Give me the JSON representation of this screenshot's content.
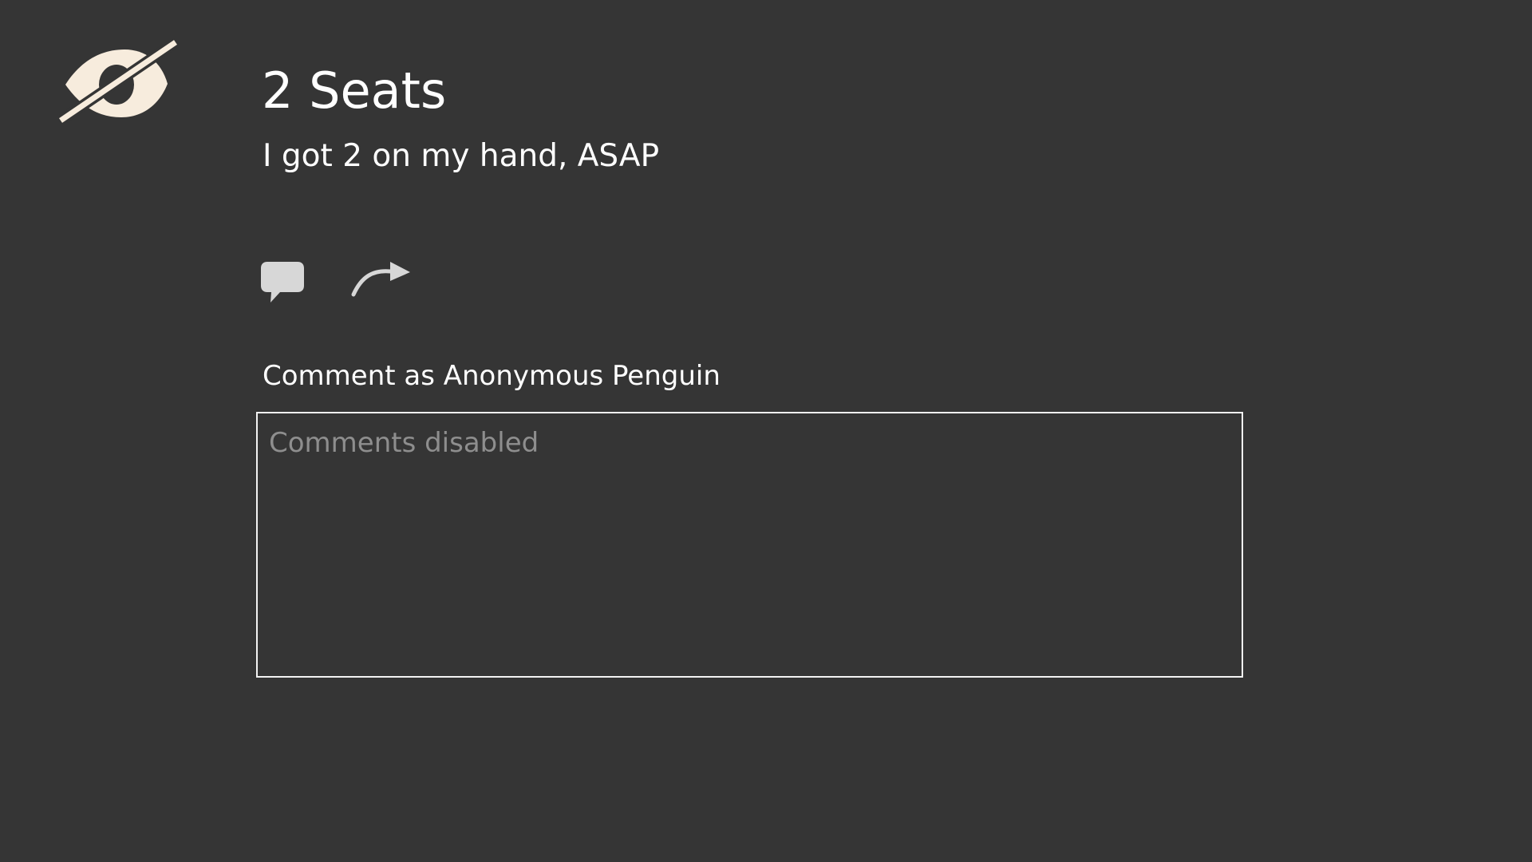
{
  "post": {
    "title": "2 Seats",
    "body": "I got 2 on my hand, ASAP"
  },
  "actions": {
    "comment_icon": "speech-bubble-icon",
    "share_icon": "share-arrow-icon"
  },
  "comment": {
    "label": "Comment as Anonymous Penguin",
    "placeholder": "Comments disabled",
    "value": ""
  },
  "status_icon": "hidden-eye-icon",
  "colors": {
    "background": "#353535",
    "text": "#ffffff",
    "icon_cream": "#f7ecdd",
    "icon_gray": "#d7d7d7",
    "placeholder": "#8e8e8e",
    "border": "#f3f3f3"
  }
}
